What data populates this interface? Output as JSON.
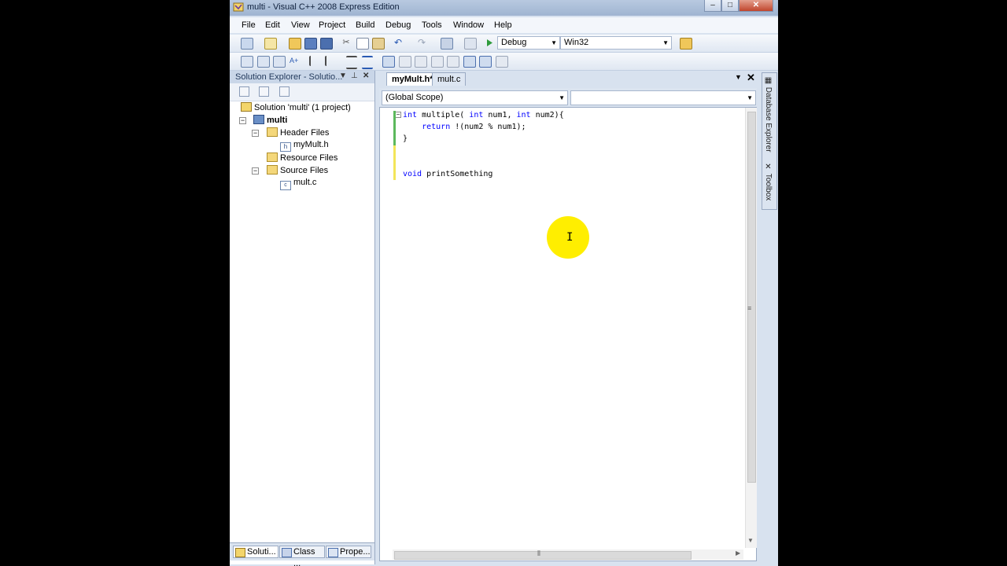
{
  "window": {
    "title": "multi - Visual C++ 2008 Express Edition",
    "controls": {
      "minimize": "–",
      "maximize": "□",
      "close": "✕"
    }
  },
  "menu": [
    "File",
    "Edit",
    "View",
    "Project",
    "Build",
    "Debug",
    "Tools",
    "Window",
    "Help"
  ],
  "toolbar": {
    "configuration": "Debug",
    "platform": "Win32"
  },
  "solution_explorer": {
    "title": "Solution Explorer - Solutio...",
    "tree": [
      {
        "label": "Solution 'multi' (1 project)",
        "icon": "solution-icon"
      },
      {
        "label": "multi",
        "icon": "project-icon",
        "bold": true
      },
      {
        "label": "Header Files",
        "icon": "folder-icon"
      },
      {
        "label": "myMult.h",
        "icon": "header-file-icon"
      },
      {
        "label": "Resource Files",
        "icon": "folder-icon"
      },
      {
        "label": "Source Files",
        "icon": "folder-icon"
      },
      {
        "label": "mult.c",
        "icon": "c-source-file-icon"
      }
    ],
    "bottom_tabs": [
      "Soluti...",
      "Class ...",
      "Prope..."
    ]
  },
  "editor": {
    "tabs": [
      {
        "label": "myMult.h*",
        "active": true
      },
      {
        "label": "mult.c",
        "active": false
      }
    ],
    "scope": "(Global Scope)",
    "member": "",
    "code_lines": [
      {
        "parts": [
          {
            "t": "int",
            "kw": true
          },
          {
            "t": " multiple( "
          },
          {
            "t": "int",
            "kw": true
          },
          {
            "t": " num1, "
          },
          {
            "t": "int",
            "kw": true
          },
          {
            "t": " num2){"
          }
        ]
      },
      {
        "parts": [
          {
            "t": "    "
          },
          {
            "t": "return",
            "kw": true
          },
          {
            "t": " !(num2 % num1);"
          }
        ]
      },
      {
        "parts": [
          {
            "t": "}"
          }
        ]
      },
      {
        "parts": [
          {
            "t": ""
          }
        ]
      },
      {
        "parts": [
          {
            "t": "void",
            "kw": true
          },
          {
            "t": " printSomething"
          }
        ]
      }
    ]
  },
  "side_tabs": [
    "Database Explorer",
    "Toolbox"
  ],
  "colors": {
    "keyword": "#0000ff",
    "saved_change_marker": "#5cb85c",
    "unsaved_change_marker": "#f3e55a",
    "cursor_highlight": "#ffee00"
  }
}
